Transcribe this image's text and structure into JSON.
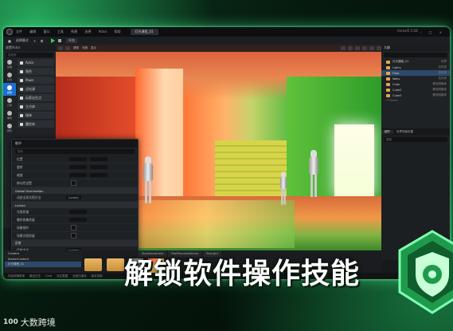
{
  "window": {
    "tab_label": "灯光课程_01",
    "project_name": "Unreal5.5 DE",
    "menu": [
      "文件",
      "编辑",
      "窗口",
      "工具",
      "构建",
      "选择",
      "Actor",
      "帮助"
    ],
    "win_controls": "– □ ×"
  },
  "toolbar": {
    "save_label": "保存",
    "mode_label": "选择模式",
    "platform_label": "平台"
  },
  "place_actors": {
    "title": "放置Actor",
    "search_placeholder": "搜索类",
    "categories": [
      "基础",
      "灯光",
      "视觉",
      "几何",
      "体积",
      "所有"
    ],
    "items": [
      "Actor",
      "角色",
      "Pawn",
      "点光源",
      "玩家出生点",
      "立方体",
      "球体",
      "圆柱体",
      "锥形体",
      "平面",
      "盒体触发器"
    ]
  },
  "viewport": {
    "perspective_label": "透视",
    "lit_label": "光照",
    "show_label": "显示"
  },
  "details_panel": {
    "title": "细节",
    "search_placeholder": "搜索",
    "rows": [
      {
        "label": "位置",
        "v1": "0.0",
        "v2": "0.0"
      },
      {
        "label": "旋转",
        "v1": "0.0",
        "v2": "0.0"
      },
      {
        "label": "缩放",
        "v1": "1.0",
        "v2": "1.0"
      },
      {
        "label": "移动性设置",
        "v1": "",
        "v2": ""
      }
    ],
    "section_global": "Global Illumination",
    "gi_label": "动态全局光照方法",
    "gi_value": "Lumen",
    "section_lumen": "Lumen",
    "lumen_rows": [
      "光照质量",
      "最终收集质量",
      "场景细节",
      "场景光照质量",
      "光照刷新速率"
    ],
    "section_reflection": "反射",
    "reflection_label": "反射方法",
    "reflection_value": "Lumen",
    "extra_rows": [
      "高质量半透明反射",
      "光线追踪反射"
    ]
  },
  "outliner": {
    "title": "大纲",
    "search_placeholder": "搜索",
    "rows": [
      {
        "name": "灯光课程_01",
        "type": "世界"
      },
      {
        "name": "Lights",
        "type": "文件夹"
      },
      {
        "name": "Floor",
        "type": "文件夹"
      },
      {
        "name": "Walls",
        "type": "文件夹"
      },
      {
        "name": "Cube",
        "type": "静态网格体"
      },
      {
        "name": "Cube2",
        "type": "静态网格体"
      },
      {
        "name": "Cube3",
        "type": "静态网格体"
      }
    ],
    "count": "7个Actor"
  },
  "right_details": {
    "tabs": [
      "细节",
      "世界场景设置"
    ],
    "search_placeholder": "搜索"
  },
  "content_browser": {
    "tree": [
      "Content",
      "StarterContent",
      "灯光课程_01"
    ],
    "tabs": [
      "SkyAtmosphere",
      "PostProcessVolume",
      "SkyLight"
    ],
    "count": "4 项"
  },
  "status_bar": {
    "items": [
      "内容侧滑菜单",
      "输出日志",
      "Cmd",
      "派生数据",
      "全部已保存",
      "版本控制"
    ]
  },
  "overlay": {
    "title": "解锁软件操作技能"
  },
  "watermark": {
    "mark": "100",
    "brand": "大数跨境"
  },
  "colors": {
    "accent_green": "#3ecf4a",
    "glow_green": "#46ff96",
    "selection_blue": "#1c6fd1"
  }
}
